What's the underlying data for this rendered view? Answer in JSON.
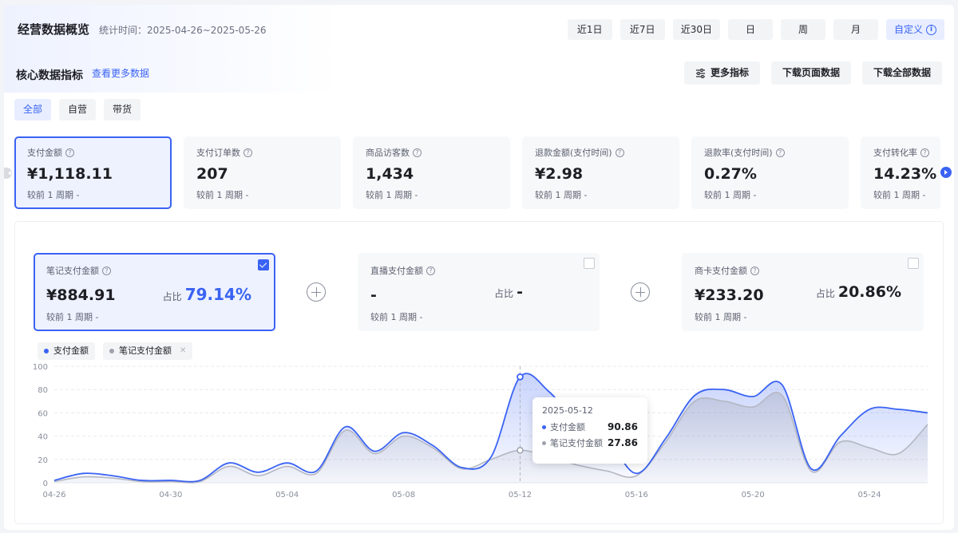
{
  "header": {
    "title": "经营数据概览",
    "range": "统计时间：2025-04-26~2025-05-26"
  },
  "range_buttons": [
    "近1日",
    "近7日",
    "近30日",
    "日",
    "周",
    "月"
  ],
  "custom_button": "自定义",
  "core": {
    "title": "核心数据指标",
    "more_link": "查看更多数据"
  },
  "actions": {
    "more_metrics": "更多指标",
    "download_page": "下载页面数据",
    "download_all": "下载全部数据"
  },
  "filter_tabs": [
    "全部",
    "自营",
    "带货"
  ],
  "kpis": [
    {
      "label": "支付金额",
      "value": "¥1,118.11",
      "compare": "较前 1 周期  -"
    },
    {
      "label": "支付订单数",
      "value": "207",
      "compare": "较前 1 周期  -"
    },
    {
      "label": "商品访客数",
      "value": "1,434",
      "compare": "较前 1 周期  -"
    },
    {
      "label": "退款金额(支付时间)",
      "value": "¥2.98",
      "compare": "较前 1 周期  -"
    },
    {
      "label": "退款率(支付时间)",
      "value": "0.27%",
      "compare": "较前 1 周期  -"
    },
    {
      "label": "支付转化率",
      "value": "14.23%",
      "compare": "较前 1 周期  -"
    }
  ],
  "channels": [
    {
      "label": "笔记支付金额",
      "value": "¥884.91",
      "share_label": "占比",
      "share": "79.14%",
      "compare": "较前 1 周期  -"
    },
    {
      "label": "直播支付金额",
      "value": "-",
      "share_label": "占比",
      "share": "-",
      "compare": "较前 1 周期  -"
    },
    {
      "label": "商卡支付金额",
      "value": "¥233.20",
      "share_label": "占比",
      "share": "20.86%",
      "compare": "较前 1 周期  -"
    }
  ],
  "legend": [
    "支付金额",
    "笔记支付金额"
  ],
  "colors": {
    "accent": "#3a63f3",
    "secondary": "#b4b7c2"
  },
  "tooltip": {
    "date": "2025-05-12",
    "rows": [
      {
        "name": "支付金额",
        "value": "90.86"
      },
      {
        "name": "笔记支付金额",
        "value": "27.86"
      }
    ]
  },
  "chart_data": {
    "type": "area",
    "ylim": [
      0,
      100
    ],
    "yticks": [
      0,
      20,
      40,
      60,
      80,
      100
    ],
    "xticks": [
      "04-26",
      "04-30",
      "05-04",
      "05-08",
      "05-12",
      "05-16",
      "05-20",
      "05-24"
    ],
    "x": [
      "04-26",
      "04-27",
      "04-28",
      "04-29",
      "04-30",
      "05-01",
      "05-02",
      "05-03",
      "05-04",
      "05-05",
      "05-06",
      "05-07",
      "05-08",
      "05-09",
      "05-10",
      "05-11",
      "05-12",
      "05-13",
      "05-14",
      "05-15",
      "05-16",
      "05-17",
      "05-18",
      "05-19",
      "05-20",
      "05-21",
      "05-22",
      "05-23",
      "05-24",
      "05-25",
      "05-26"
    ],
    "series": [
      {
        "name": "支付金额",
        "values": [
          2,
          8,
          6,
          2,
          2,
          2,
          17,
          9,
          17,
          10,
          48,
          27,
          43,
          32,
          13,
          22,
          90.86,
          78,
          50,
          37,
          8,
          38,
          75,
          80,
          74,
          84,
          12,
          40,
          63,
          63,
          60
        ]
      },
      {
        "name": "笔记支付金额",
        "values": [
          1,
          5,
          4,
          1,
          1,
          1,
          14,
          6,
          14,
          8,
          45,
          25,
          40,
          30,
          12,
          20,
          27.86,
          22,
          15,
          10,
          6,
          35,
          70,
          70,
          65,
          75,
          10,
          35,
          30,
          25,
          50
        ]
      }
    ]
  }
}
